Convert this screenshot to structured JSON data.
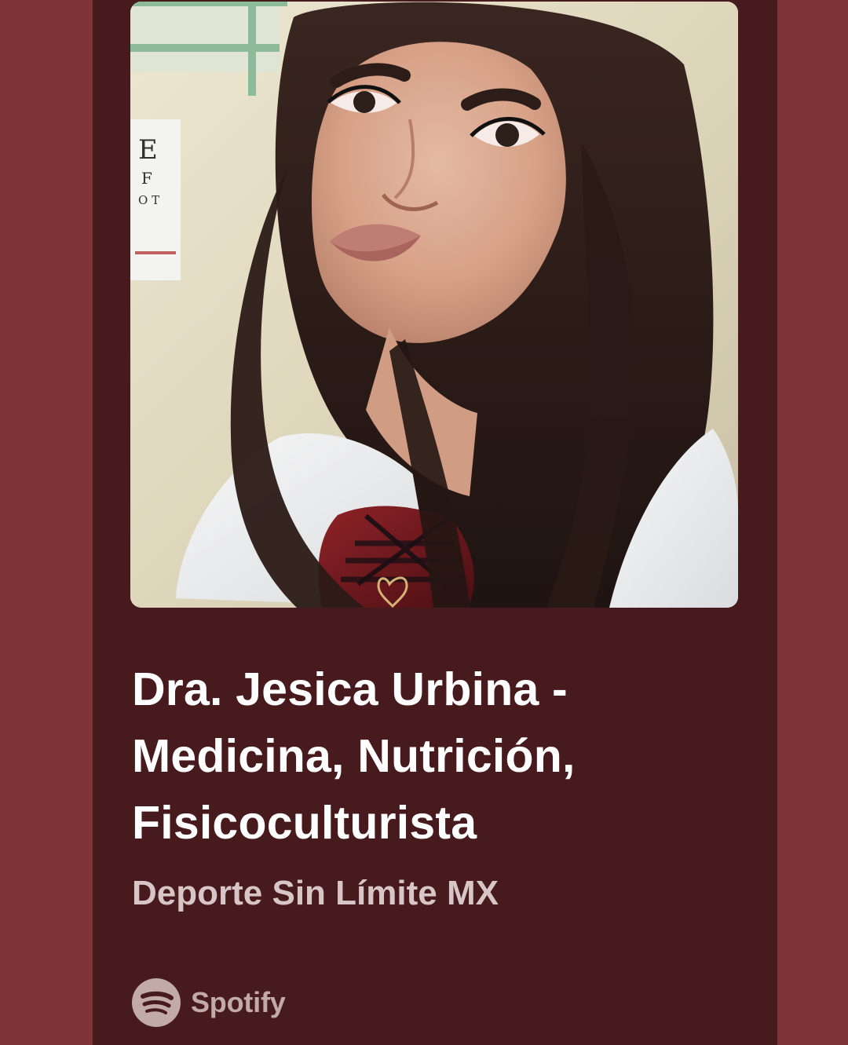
{
  "colors": {
    "outer_bg": "#7d3537",
    "card_bg": "#471a1d",
    "title": "#ffffff",
    "subtitle": "#d8c5c6",
    "spotify_mark": "#c2aaa9"
  },
  "cover": {
    "alt": "Podcast cover photo"
  },
  "episode": {
    "title": "Dra. Jesica Urbina - Medicina, Nutrición, Fisicoculturista",
    "show": "Deporte Sin Límite MX"
  },
  "brand": {
    "icon": "spotify-icon",
    "name": "Spotify"
  }
}
